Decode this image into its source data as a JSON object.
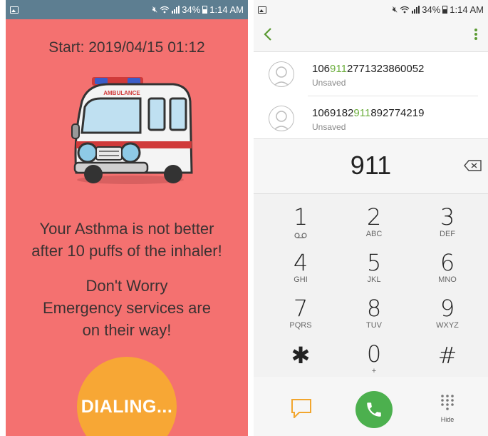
{
  "left_screen": {
    "status": {
      "battery": "34%",
      "time": "1:14 AM"
    },
    "start_text": "Start: 2019/04/15 01:12",
    "ambulance_label": "AMBULANCE",
    "message1": [
      "Your Asthma is not better",
      "after 10 puffs of the inhaler!"
    ],
    "message2": [
      "Don't Worry",
      "Emergency services are",
      "on their way!"
    ],
    "dialing_label": "DIALING...",
    "colors": {
      "background": "#f47170",
      "statusbar": "#5d7e91",
      "dial_button": "#f7a735"
    }
  },
  "right_screen": {
    "status": {
      "battery": "34%",
      "time": "1:14 AM"
    },
    "contacts": [
      {
        "num_pre": "106",
        "num_hl": "911",
        "num_post": "2771323860052",
        "sub": "Unsaved"
      },
      {
        "num_pre": "1069182",
        "num_hl": "911",
        "num_post": "892774219",
        "sub": "Unsaved"
      }
    ],
    "typed_number": "911",
    "keys": [
      {
        "digit": "1",
        "letters": ""
      },
      {
        "digit": "2",
        "letters": "ABC"
      },
      {
        "digit": "3",
        "letters": "DEF"
      },
      {
        "digit": "4",
        "letters": "GHI"
      },
      {
        "digit": "5",
        "letters": "JKL"
      },
      {
        "digit": "6",
        "letters": "MNO"
      },
      {
        "digit": "7",
        "letters": "PQRS"
      },
      {
        "digit": "8",
        "letters": "TUV"
      },
      {
        "digit": "9",
        "letters": "WXYZ"
      },
      {
        "digit": "✱",
        "letters": ""
      },
      {
        "digit": "0",
        "letters": "+"
      },
      {
        "digit": "#",
        "letters": ""
      }
    ],
    "hide_label": "Hide",
    "icons": [
      "back-arrow-icon",
      "more-options-icon",
      "contact-avatar-icon",
      "backspace-icon",
      "voicemail-icon",
      "message-icon",
      "phone-icon",
      "keypad-icon"
    ],
    "colors": {
      "accent": "#6cae3d",
      "call_button": "#4cb04e",
      "message_icon": "#f2a62e"
    }
  }
}
